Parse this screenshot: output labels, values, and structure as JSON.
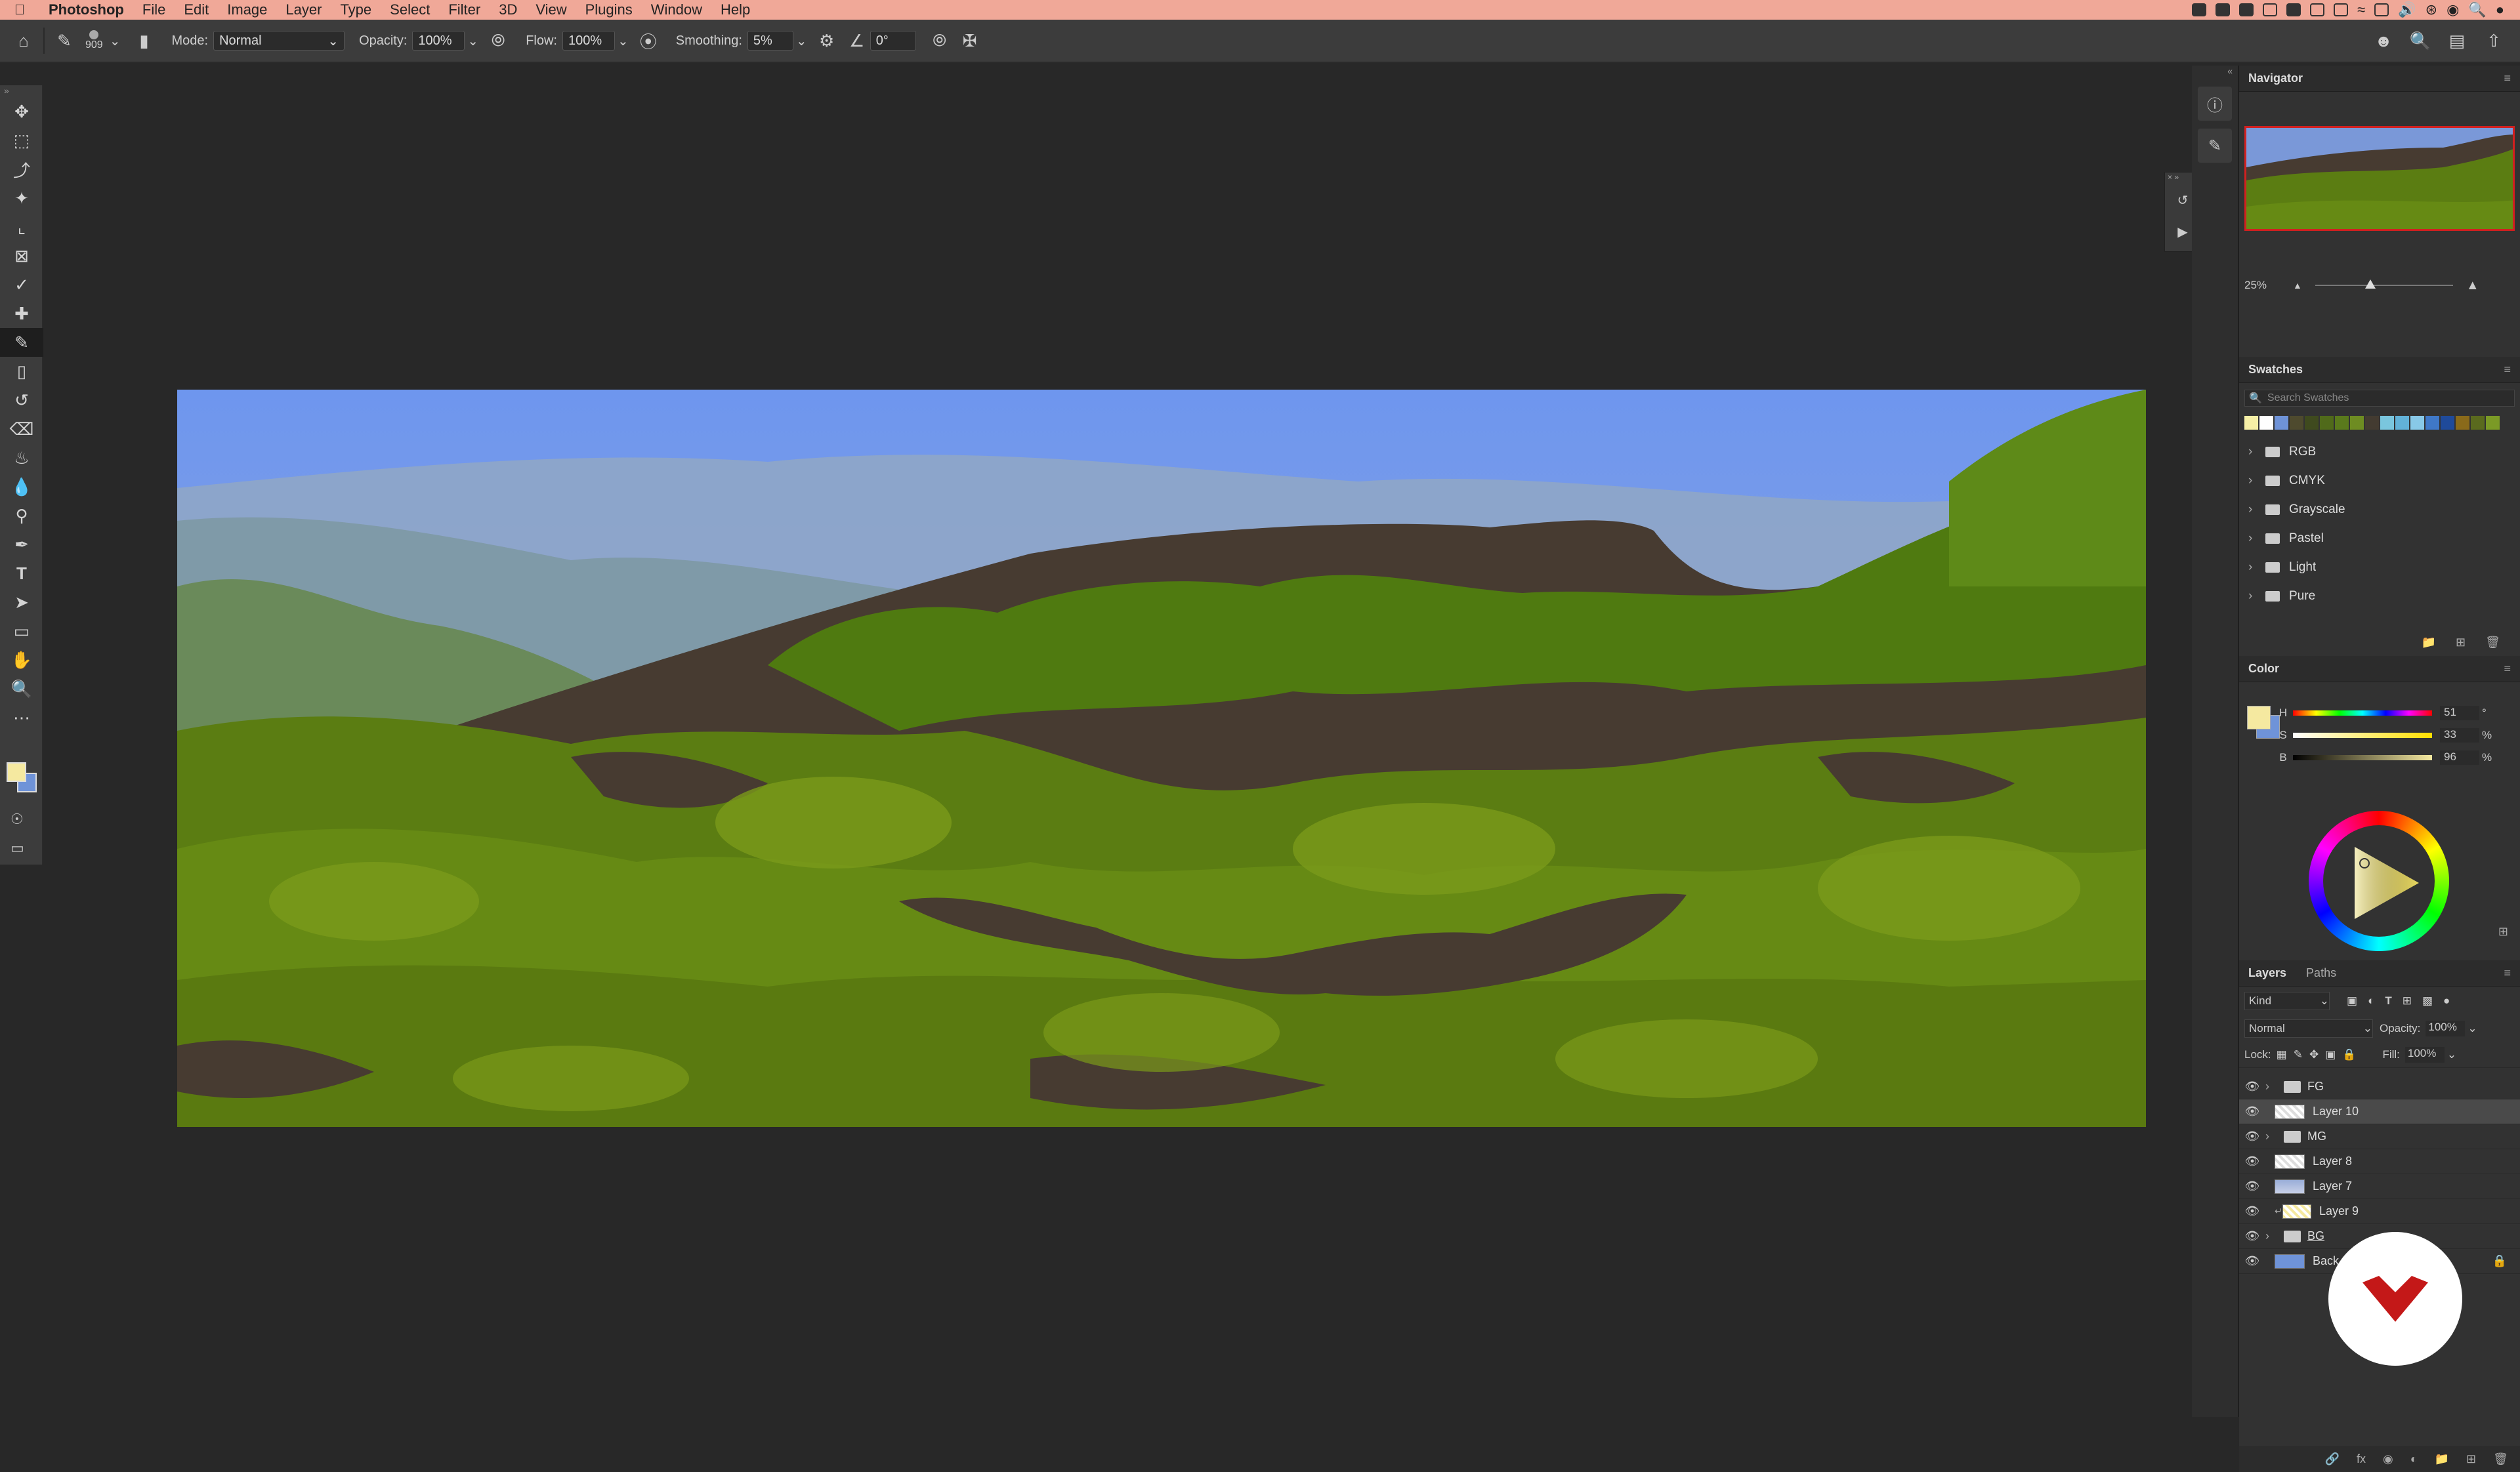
{
  "menubar": {
    "app": "Photoshop",
    "items": [
      "File",
      "Edit",
      "Image",
      "Layer",
      "Type",
      "Select",
      "Filter",
      "3D",
      "View",
      "Plugins",
      "Window",
      "Help"
    ]
  },
  "options": {
    "brush_size": "909",
    "mode_label": "Mode:",
    "mode_value": "Normal",
    "opacity_label": "Opacity:",
    "opacity_value": "100%",
    "flow_label": "Flow:",
    "flow_value": "100%",
    "smoothing_label": "Smoothing:",
    "smoothing_value": "5%",
    "angle_value": "0°"
  },
  "toolbar": {
    "tools": [
      "move-tool",
      "marquee-tool",
      "lasso-tool",
      "magic-wand-tool",
      "crop-tool",
      "frame-tool",
      "eyedropper-tool",
      "healing-tool",
      "brush-tool",
      "stamp-tool",
      "history-brush-tool",
      "eraser-tool",
      "paint-bucket-tool",
      "blur-tool",
      "dodge-tool",
      "pen-tool",
      "type-tool",
      "path-selection-tool",
      "rectangle-tool",
      "hand-tool",
      "zoom-tool",
      "more-tools"
    ],
    "foreground_color": "#f5e9a0",
    "background_color": "#6f93d8"
  },
  "navigator": {
    "title": "Navigator",
    "zoom": "25%"
  },
  "swatches": {
    "title": "Swatches",
    "search_placeholder": "Search Swatches",
    "colors": [
      "#f6efa6",
      "#ffffff",
      "#6f93d8",
      "#4e4a2e",
      "#3f4a1e",
      "#506a1a",
      "#5a7a1c",
      "#6e8c22",
      "#433b31",
      "#7ac6de",
      "#62b2d8",
      "#88c9e8",
      "#3f78c8",
      "#1f4a9a",
      "#8a6a1a",
      "#5a6a1e",
      "#7b9a26"
    ],
    "groups": [
      "RGB",
      "CMYK",
      "Grayscale",
      "Pastel",
      "Light",
      "Pure"
    ]
  },
  "color": {
    "title": "Color",
    "h_label": "H",
    "h_value": "51",
    "s_label": "S",
    "s_value": "33",
    "b_label": "B",
    "b_value": "96",
    "pct": "%",
    "deg": "°"
  },
  "layers": {
    "tabs": [
      "Layers",
      "Paths"
    ],
    "kind": "Kind",
    "blend_mode": "Normal",
    "opacity_label": "Opacity:",
    "opacity_value": "100%",
    "lock_label": "Lock:",
    "fill_label": "Fill:",
    "fill_value": "100%",
    "items": [
      {
        "name": "FG",
        "type": "group",
        "selected": false
      },
      {
        "name": "Layer 10",
        "type": "layer",
        "selected": true
      },
      {
        "name": "MG",
        "type": "group",
        "selected": false
      },
      {
        "name": "Layer 8",
        "type": "layer",
        "selected": false
      },
      {
        "name": "Layer 7",
        "type": "layer",
        "selected": false
      },
      {
        "name": "Layer 9",
        "type": "clipped-layer",
        "selected": false
      },
      {
        "name": "BG",
        "type": "group",
        "selected": false
      },
      {
        "name": "Back",
        "type": "background",
        "selected": false
      }
    ]
  }
}
